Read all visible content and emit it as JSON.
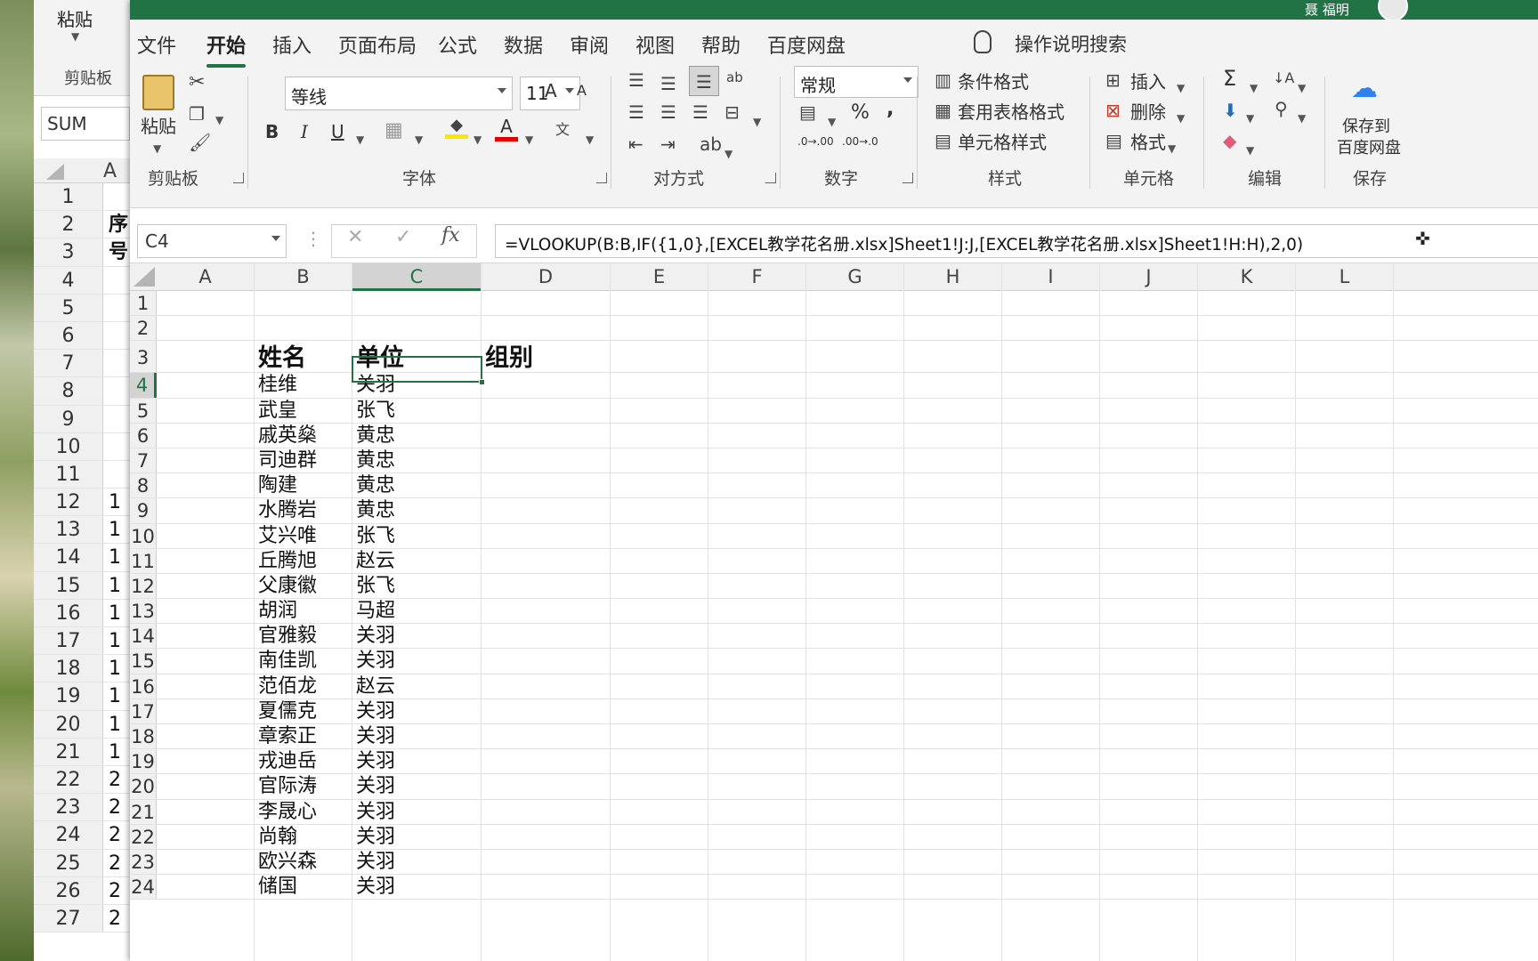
{
  "back": {
    "paste_label": "粘贴",
    "clipboard_label": "剪贴板",
    "namebox": "SUM",
    "col_a": "A",
    "rows": [
      {
        "n": "1",
        "v": ""
      },
      {
        "n": "2",
        "v": "序号",
        "bold": true
      },
      {
        "n": "3",
        "v": ""
      },
      {
        "n": "4",
        "v": ""
      },
      {
        "n": "5",
        "v": ""
      },
      {
        "n": "6",
        "v": ""
      },
      {
        "n": "7",
        "v": ""
      },
      {
        "n": "8",
        "v": ""
      },
      {
        "n": "9",
        "v": ""
      },
      {
        "n": "10",
        "v": ""
      },
      {
        "n": "11",
        "v": ""
      },
      {
        "n": "12",
        "v": "1"
      },
      {
        "n": "13",
        "v": "1"
      },
      {
        "n": "14",
        "v": "1"
      },
      {
        "n": "15",
        "v": "1"
      },
      {
        "n": "16",
        "v": "1"
      },
      {
        "n": "17",
        "v": "1"
      },
      {
        "n": "18",
        "v": "1"
      },
      {
        "n": "19",
        "v": "1"
      },
      {
        "n": "20",
        "v": "1"
      },
      {
        "n": "21",
        "v": "1"
      },
      {
        "n": "22",
        "v": "2"
      },
      {
        "n": "23",
        "v": "2"
      },
      {
        "n": "24",
        "v": "2"
      },
      {
        "n": "25",
        "v": "2"
      },
      {
        "n": "26",
        "v": "2"
      },
      {
        "n": "27",
        "v": "2"
      }
    ]
  },
  "title": {
    "user": "聂 福明"
  },
  "menu": {
    "tabs": [
      "文件",
      "开始",
      "插入",
      "页面布局",
      "公式",
      "数据",
      "审阅",
      "视图",
      "帮助",
      "百度网盘"
    ],
    "active": "开始",
    "search": "操作说明搜索"
  },
  "ribbon": {
    "clipboard": {
      "paste": "粘贴",
      "label": "剪贴板"
    },
    "font": {
      "name": "等线",
      "size": "11",
      "bold": "B",
      "italic": "I",
      "underline": "U",
      "label": "字体",
      "grow": "A",
      "shrink": "A"
    },
    "align": {
      "label": "对方式"
    },
    "number": {
      "format": "常规",
      "percent": "%",
      "comma": ",",
      "label": "数字",
      "inc": ".0→.00",
      "dec": ".00→.0"
    },
    "styles": {
      "cond": "条件格式",
      "table": "套用表格格式",
      "cell": "单元格样式",
      "label": "样式"
    },
    "cells": {
      "insert": "插入",
      "delete": "删除",
      "format": "格式",
      "label": "单元格"
    },
    "editing": {
      "label": "编辑",
      "sum": "Σ"
    },
    "save": {
      "line1": "保存到",
      "line2": "百度网盘",
      "label": "保存"
    }
  },
  "formula_bar": {
    "namebox": "C4",
    "formula": "=VLOOKUP(B:B,IF({1,0},[EXCEL教学花名册.xlsx]Sheet1!J:J,[EXCEL教学花名册.xlsx]Sheet1!H:H),2,0)"
  },
  "columns": [
    "A",
    "B",
    "C",
    "D",
    "E",
    "F",
    "G",
    "H",
    "I",
    "J",
    "K",
    "L"
  ],
  "selected_cell": "C4",
  "sheet": {
    "rows": [
      {
        "n": "1",
        "b": "",
        "c": "",
        "d": ""
      },
      {
        "n": "2",
        "b": "",
        "c": "",
        "d": ""
      },
      {
        "n": "3",
        "b": "姓名",
        "c": "单位",
        "d": "组别",
        "header": true
      },
      {
        "n": "4",
        "b": "桂维",
        "c": "关羽",
        "d": ""
      },
      {
        "n": "5",
        "b": "武皇",
        "c": "张飞",
        "d": ""
      },
      {
        "n": "6",
        "b": "戚英燊",
        "c": "黄忠",
        "d": ""
      },
      {
        "n": "7",
        "b": "司迪群",
        "c": "黄忠",
        "d": ""
      },
      {
        "n": "8",
        "b": "陶建",
        "c": "黄忠",
        "d": ""
      },
      {
        "n": "9",
        "b": "水腾岩",
        "c": "黄忠",
        "d": ""
      },
      {
        "n": "10",
        "b": "艾兴唯",
        "c": "张飞",
        "d": ""
      },
      {
        "n": "11",
        "b": "丘腾旭",
        "c": "赵云",
        "d": ""
      },
      {
        "n": "12",
        "b": "父康徽",
        "c": "张飞",
        "d": ""
      },
      {
        "n": "13",
        "b": "胡润",
        "c": "马超",
        "d": ""
      },
      {
        "n": "14",
        "b": "官雅毅",
        "c": "关羽",
        "d": ""
      },
      {
        "n": "15",
        "b": "南佳凯",
        "c": "关羽",
        "d": ""
      },
      {
        "n": "16",
        "b": "范佰龙",
        "c": "赵云",
        "d": ""
      },
      {
        "n": "17",
        "b": "夏儒克",
        "c": "关羽",
        "d": ""
      },
      {
        "n": "18",
        "b": "章索正",
        "c": "关羽",
        "d": ""
      },
      {
        "n": "19",
        "b": "戎迪岳",
        "c": "关羽",
        "d": ""
      },
      {
        "n": "20",
        "b": "官际涛",
        "c": "关羽",
        "d": ""
      },
      {
        "n": "21",
        "b": "李晟心",
        "c": "关羽",
        "d": ""
      },
      {
        "n": "22",
        "b": "尚翰",
        "c": "关羽",
        "d": ""
      },
      {
        "n": "23",
        "b": "欧兴森",
        "c": "关羽",
        "d": ""
      },
      {
        "n": "24",
        "b": "储国",
        "c": "关羽",
        "d": ""
      }
    ]
  }
}
